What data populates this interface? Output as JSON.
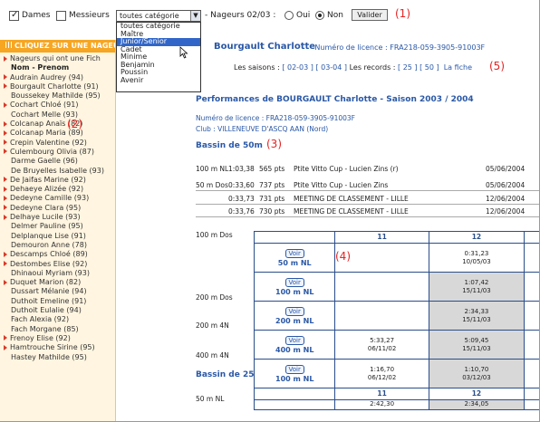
{
  "filters": {
    "dames_label": "Dames",
    "messieurs_label": "Messieurs",
    "category_selected": "toutes catégorie",
    "nageurs_label": "- Nageurs 02/03 :",
    "oui_label": "Oui",
    "non_label": "Non",
    "valider_label": "Valider",
    "category_options": [
      "toutes catégorie",
      "Maître",
      "Junior/Senior",
      "Cadet",
      "Minime",
      "Benjamin",
      "Poussin",
      "Avenir"
    ]
  },
  "annotations": [
    "(1)",
    "(2)",
    "(3)",
    "(4)",
    "(5)"
  ],
  "sidebar": {
    "header": "CLIQUEZ SUR UNE NAGEU",
    "intro_line1": "Nageurs qui ont une Fich",
    "intro_line2": "Nom - Prenom",
    "swimmers": [
      "Audrain Audrey (94)",
      "Bourgault Charlotte (91)",
      "Boussekey Mathilde (95)",
      "Cochart Chloé (91)",
      "Cochart Melle (93)",
      "Colcanap Anaïs (82)",
      "Colcanap Maria (89)",
      "Crepin Valentine (92)",
      "Culembourg Olivia (87)",
      "Darme Gaelle (96)",
      "De Bruyelles Isabelle (93)",
      "De Jaifas Marine (92)",
      "Dehaeye Alizée (92)",
      "Dedeyne Camille (93)",
      "Dedeyne Clara (95)",
      "Delhaye Lucile (93)",
      "Delmer Pauline (95)",
      "Delplanque Lise (91)",
      "Demouron Anne (78)",
      "Descamps Chloé (89)",
      "Destombes Elise (92)",
      "Dhinaoui Myriam (93)",
      "Duquet Marion (82)",
      "Dussart Mélanie (94)",
      "Duthoit Emeline (91)",
      "Duthoit Eulalie (94)",
      "Fach Alexia (92)",
      "Fach Morgane (85)",
      "Frenoy Elise (92)",
      "Hamtrouche Sirine (95)",
      "Hastey Mathilde (95)"
    ]
  },
  "profile": {
    "name": "Bourgault Charlotte",
    "licence_label": "- Numéro de licence : FRA218-059-3905-91003F",
    "seasons_prefix": "Les saisons : ",
    "season_links": "[ 02-03 ] [ 03-04 ]",
    "records_prefix": " Les records : ",
    "records_links": "[ 25 ] [ 50 ]",
    "fiche_label": "La fiche",
    "perf_title": "Performances de BOURGAULT Charlotte - Saison 2003 / 2004",
    "licence_line": "Numéro de licence : FRA218-059-3905-91003F",
    "club_line": "Club : VILLENEUVE D'ASCQ AAN (Nord)",
    "bassin_50": "Bassin de 50m",
    "bassin_25": "Bassin de 25"
  },
  "results": [
    {
      "event": "100 m NL",
      "time": "1:03,38",
      "pts": "565 pts",
      "meet": "Ptite Vitto Cup - Lucien Zins (r)",
      "date": "05/06/2004"
    },
    {
      "event": "50 m Dos",
      "time": "0:33,60",
      "pts": "737 pts",
      "meet": "Ptite Vitto Cup - Lucien Zins",
      "date": "05/06/2004"
    },
    {
      "event": "",
      "time": "0:33,73",
      "pts": "731 pts",
      "meet": "MEETING DE CLASSEMENT - LILLE",
      "date": "12/06/2004"
    },
    {
      "event": "",
      "time": "0:33,76",
      "pts": "730 pts",
      "meet": "MEETING DE CLASSEMENT - LILLE",
      "date": "12/06/2004"
    }
  ],
  "left_events": [
    "100 m Dos",
    "200 m Dos",
    "200 m 4N",
    "400 m 4N",
    "50 m NL"
  ],
  "table": {
    "col_headers": [
      "11",
      "12"
    ],
    "voir_label": "Voir",
    "rows": [
      {
        "event": "50 m NL",
        "v11": "",
        "v11b": "",
        "v12": "0:31,23",
        "v12b": "10/05/03"
      },
      {
        "event": "100 m NL",
        "v11": "",
        "v11b": "",
        "v12": "1:07,42",
        "v12b": "15/11/03"
      },
      {
        "event": "200 m NL",
        "v11": "",
        "v11b": "",
        "v12": "2:34,33",
        "v12b": "15/11/03"
      },
      {
        "event": "400 m NL",
        "v11": "5:33,27",
        "v11b": "06/11/02",
        "v12": "5:09,45",
        "v12b": "15/11/03"
      },
      {
        "event": "100 m NL",
        "v11": "1:16,70",
        "v11b": "06/12/02",
        "v12": "1:10,70",
        "v12b": "03/12/03"
      }
    ],
    "footer_headers": [
      "11",
      "12"
    ],
    "footer_vals": [
      "2:42,30",
      "2:34,05"
    ]
  }
}
